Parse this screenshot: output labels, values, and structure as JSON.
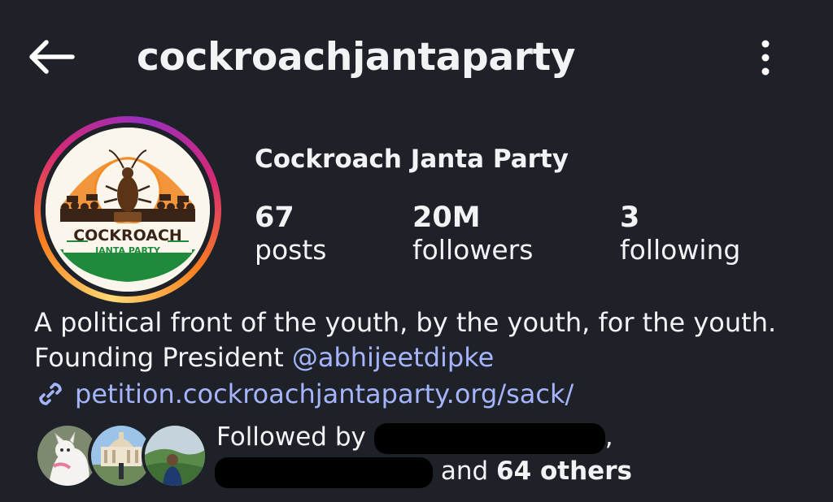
{
  "header": {
    "username": "cockroachjantaparty",
    "back_icon": "back-arrow-icon",
    "more_icon": "more-vertical-icon"
  },
  "profile": {
    "display_name": "Cockroach Janta Party",
    "avatar": {
      "logo_text_top": "COCKROACH",
      "logo_text_bottom": "JANTA PARTY"
    },
    "stats": [
      {
        "value": "67",
        "label": "posts"
      },
      {
        "value": "20M",
        "label": "followers"
      },
      {
        "value": "3",
        "label": "following"
      }
    ]
  },
  "bio": {
    "text": "A political front of the youth, by the youth, for the youth. Founding President ",
    "mention": "@abhijeetdipke",
    "link_icon": "link-icon",
    "link": "petition.cockroachjantaparty.org/sack/"
  },
  "followed_by": {
    "prefix": "Followed by",
    "suffix_separator": ",",
    "and_text": "and",
    "others": "64 others"
  },
  "colors": {
    "background": "#1e2228",
    "text": "#f2f3f5",
    "link": "#a5b4fc"
  }
}
